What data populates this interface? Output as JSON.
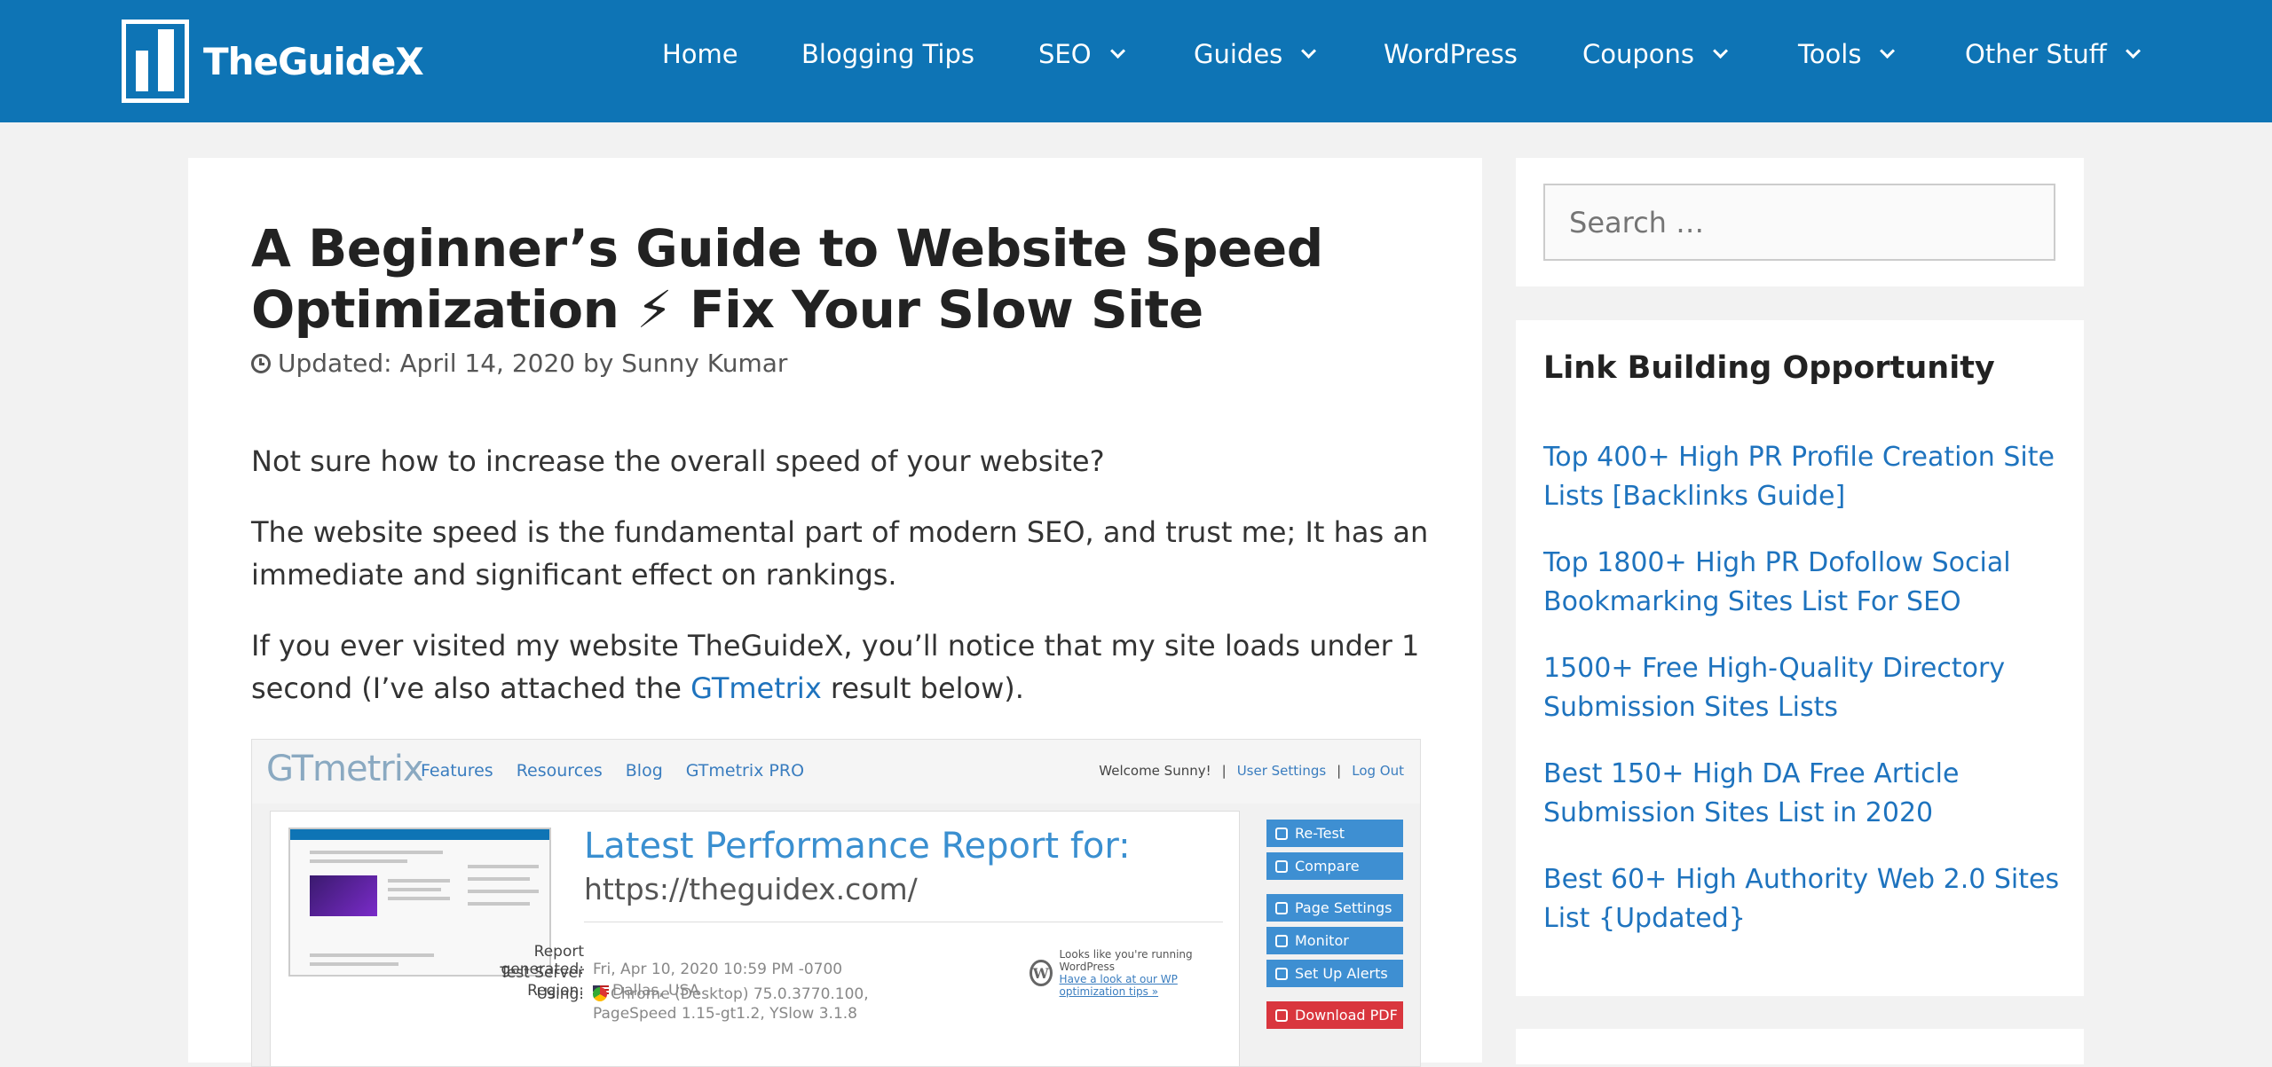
{
  "site": {
    "logo_text": "TheGuideX"
  },
  "nav": {
    "items": [
      {
        "label": "Home",
        "dropdown": false
      },
      {
        "label": "Blogging Tips",
        "dropdown": false
      },
      {
        "label": "SEO",
        "dropdown": true
      },
      {
        "label": "Guides",
        "dropdown": true
      },
      {
        "label": "WordPress",
        "dropdown": false
      },
      {
        "label": "Coupons",
        "dropdown": true
      },
      {
        "label": "Tools",
        "dropdown": true
      },
      {
        "label": "Other Stuff",
        "dropdown": true
      }
    ]
  },
  "article": {
    "title": "A Beginner’s Guide to Website Speed Optimization ⚡ Fix Your Slow Site",
    "meta": "Updated: April 14, 2020 by Sunny Kumar",
    "paragraphs": [
      "Not sure how to increase the overall speed of your website?",
      "The website speed is the fundamental part of modern SEO, and trust me; It has an immediate and significant effect on rankings."
    ],
    "para3_before": "If you ever visited my website TheGuideX, you’ll notice that my site loads under 1 second (I’ve also attached the ",
    "para3_link": "GTmetrix",
    "para3_after": " result below)."
  },
  "gtmetrix": {
    "logo_a": "GT",
    "logo_b": "metrix",
    "links": [
      "Features",
      "Resources",
      "Blog",
      "GTmetrix PRO"
    ],
    "welcome": "Welcome Sunny!",
    "user_settings": "User Settings",
    "logout": "Log Out",
    "report_title": "Latest Performance Report for:",
    "report_url": "https://theguidex.com/",
    "rows": [
      {
        "label": "Report generated:",
        "value": "Fri, Apr 10, 2020 10:59 PM -0700"
      },
      {
        "label": "Test Server Region:",
        "value": "Dallas, USA"
      },
      {
        "label": "Using:",
        "value": "Chrome (Desktop) 75.0.3770.100,"
      },
      {
        "label": "",
        "value": "PageSpeed 1.15-gt1.2, YSlow 3.1.8"
      }
    ],
    "wp_line1": "Looks like you're running WordPress",
    "wp_line2": "Have a look at our WP optimization tips »",
    "buttons": [
      "Re-Test",
      "Compare",
      "Page Settings",
      "Monitor",
      "Set Up Alerts",
      "Download PDF"
    ]
  },
  "sidebar": {
    "search_placeholder": "Search …",
    "widget_title": "Link Building Opportunity",
    "links": [
      "Top 400+ High PR Profile Creation Site Lists [Backlinks Guide]",
      "Top 1800+ High PR Dofollow Social Bookmarking Sites List For SEO",
      "1500+ Free High-Quality Directory Submission Sites Lists",
      "Best 150+ High DA Free Article Submission Sites List in 2020",
      "Best 60+ High Authority Web 2.0 Sites List {Updated}"
    ]
  },
  "colors": {
    "header": "#0e74b5",
    "link": "#1e73be"
  }
}
